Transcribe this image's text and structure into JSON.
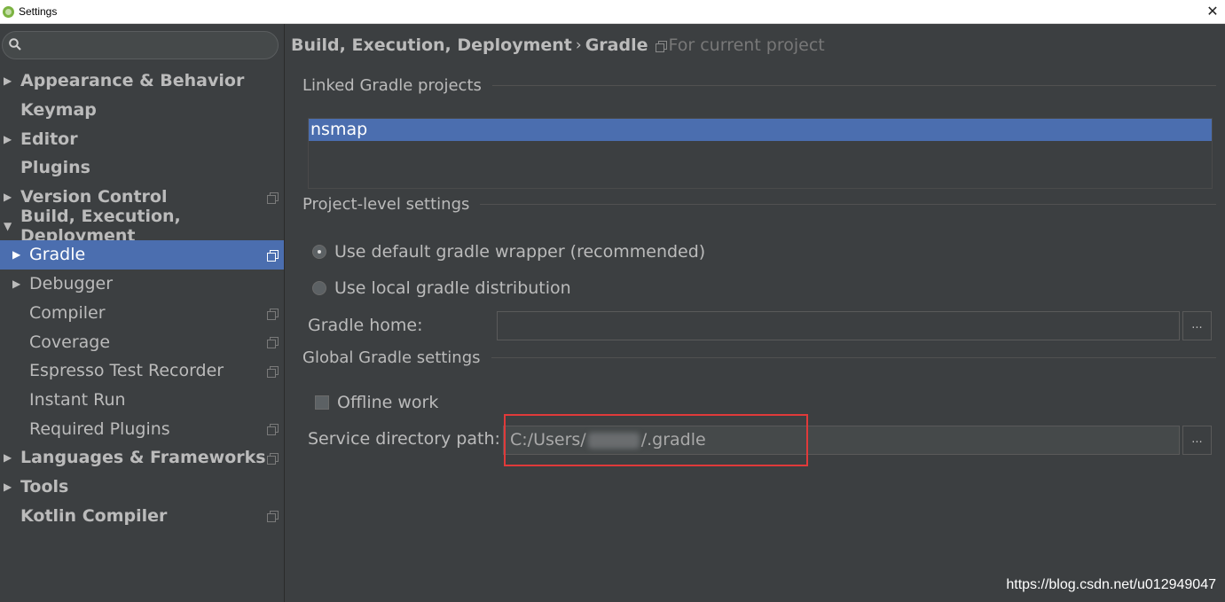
{
  "window": {
    "title": "Settings",
    "close_label": "✕"
  },
  "search": {
    "value": "",
    "placeholder": ""
  },
  "tree": {
    "items": [
      {
        "label": "Appearance & Behavior"
      },
      {
        "label": "Keymap"
      },
      {
        "label": "Editor"
      },
      {
        "label": "Plugins"
      },
      {
        "label": "Version Control"
      },
      {
        "label": "Build, Execution, Deployment"
      },
      {
        "label": "Gradle"
      },
      {
        "label": "Debugger"
      },
      {
        "label": "Compiler"
      },
      {
        "label": "Coverage"
      },
      {
        "label": "Espresso Test Recorder"
      },
      {
        "label": "Instant Run"
      },
      {
        "label": "Required Plugins"
      },
      {
        "label": "Languages & Frameworks"
      },
      {
        "label": "Tools"
      },
      {
        "label": "Kotlin Compiler"
      }
    ],
    "arrow_collapsed": "▶",
    "arrow_expanded": "▼"
  },
  "breadcrumb": {
    "parent": "Build, Execution, Deployment",
    "separator": "›",
    "current": "Gradle",
    "scope": "For current project"
  },
  "linked": {
    "title": "Linked Gradle projects",
    "projects": [
      "nsmap"
    ]
  },
  "project_level": {
    "title": "Project-level settings",
    "option_default": "Use default gradle wrapper (recommended)",
    "option_local": "Use local gradle distribution",
    "gradle_home_label": "Gradle home:",
    "gradle_home_value": "",
    "browse_label": "..."
  },
  "global": {
    "title": "Global Gradle settings",
    "offline_label": "Offline work",
    "service_label": "Service directory path:",
    "service_prefix": "C:/Users/",
    "service_suffix": "/.gradle",
    "browse_label": "..."
  },
  "watermark": "https://blog.csdn.net/u012949047",
  "colors": {
    "selection": "#4b6eaf",
    "background": "#3c3f41",
    "highlight_box": "#e03a3a"
  }
}
